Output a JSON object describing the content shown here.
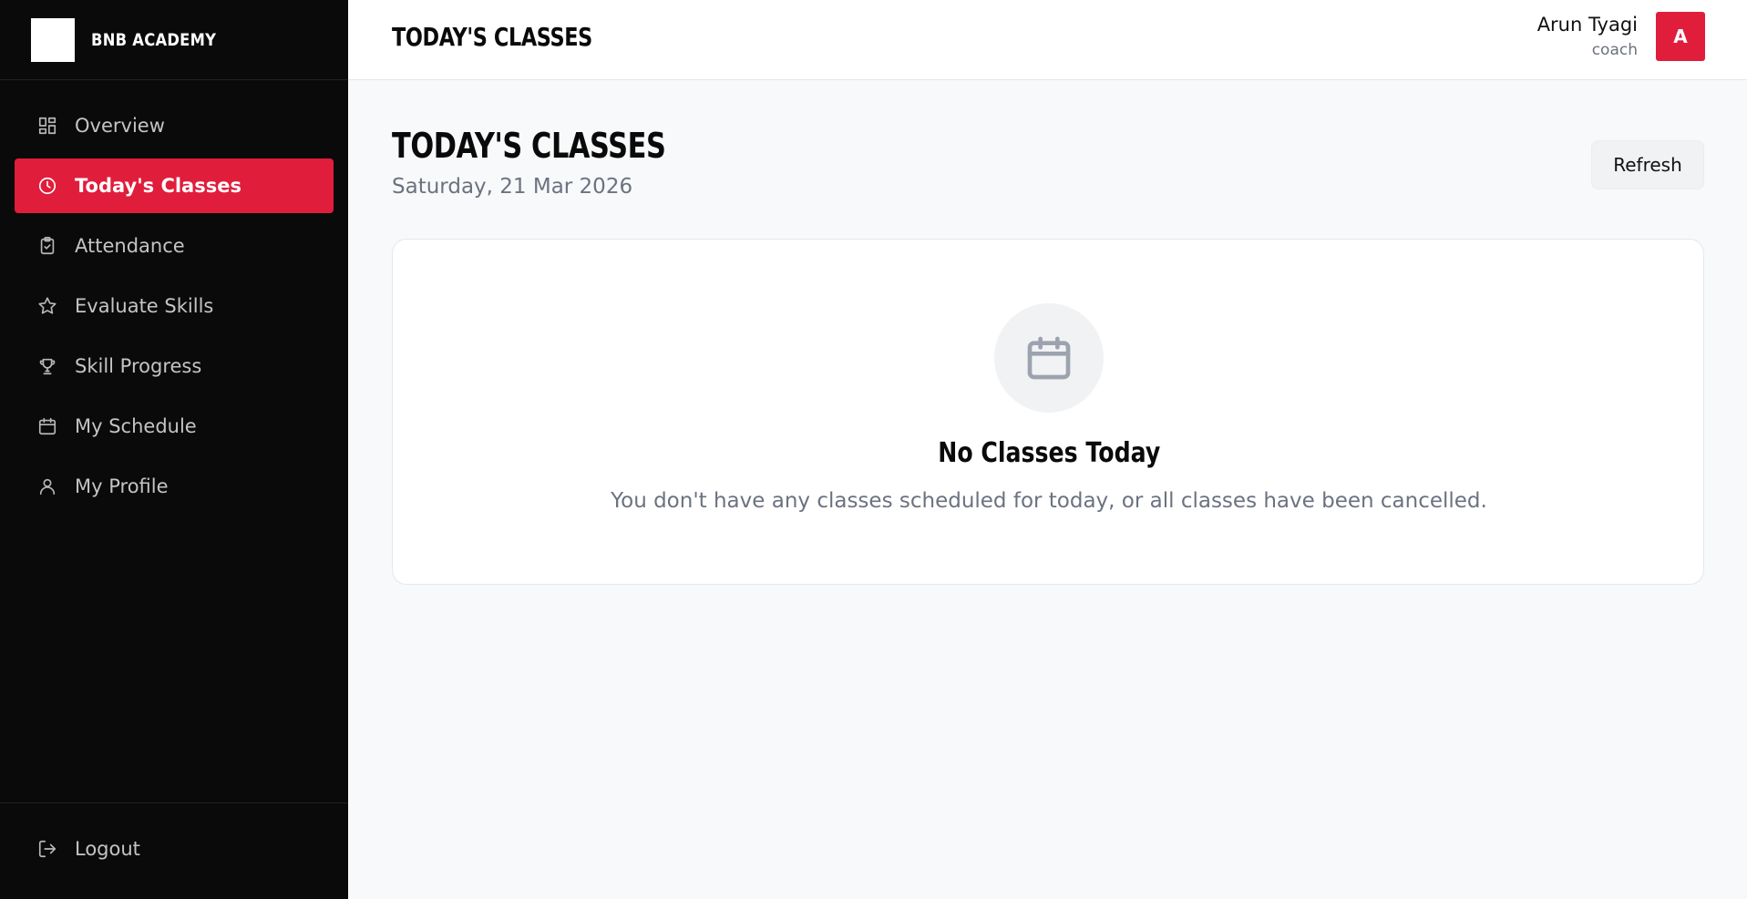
{
  "brand": {
    "name": "BNB ACADEMY"
  },
  "sidebar": {
    "items": [
      {
        "label": "Overview",
        "icon": "grid-icon",
        "active": false
      },
      {
        "label": "Today's Classes",
        "icon": "clock-icon",
        "active": true
      },
      {
        "label": "Attendance",
        "icon": "clipboard-check-icon",
        "active": false
      },
      {
        "label": "Evaluate Skills",
        "icon": "star-icon",
        "active": false
      },
      {
        "label": "Skill Progress",
        "icon": "trophy-icon",
        "active": false
      },
      {
        "label": "My Schedule",
        "icon": "calendar-icon",
        "active": false
      },
      {
        "label": "My Profile",
        "icon": "user-icon",
        "active": false
      }
    ],
    "logout_label": "Logout"
  },
  "header": {
    "title": "TODAY'S CLASSES",
    "user_name": "Arun Tyagi",
    "user_role": "coach",
    "avatar_initial": "A"
  },
  "main": {
    "title": "TODAY'S CLASSES",
    "date": "Saturday, 21 Mar 2026",
    "refresh_label": "Refresh",
    "empty_state": {
      "icon": "calendar-icon",
      "title": "No Classes Today",
      "text": "You don't have any classes scheduled for today, or all classes have been cancelled."
    }
  },
  "colors": {
    "accent": "#e11d3c",
    "sidebar_bg": "#0a0a0a",
    "page_bg": "#f8f9fa"
  }
}
